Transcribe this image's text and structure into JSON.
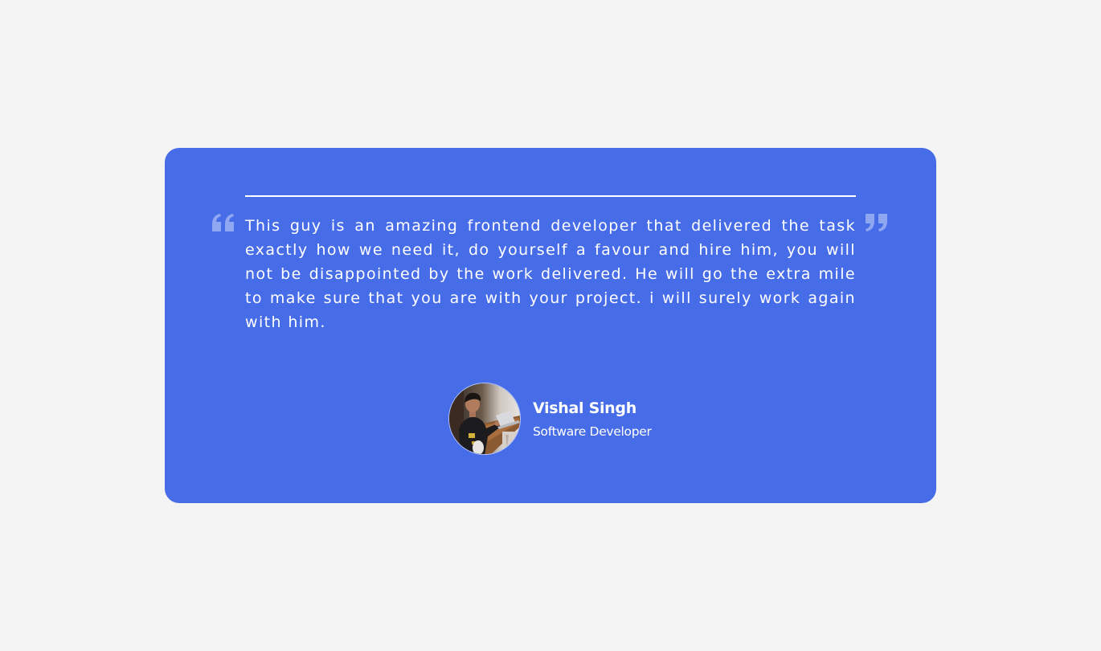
{
  "testimonial": {
    "quote": "This guy is an amazing frontend developer that delivered the task exactly how we need it, do yourself a favour and hire him, you will not be disappointed by the work delivered. He will go the extra mile to make sure that you are with your project. i will surely work again with him.",
    "progress": 1.0,
    "author": {
      "name": "Vishal Singh",
      "role": "Software Developer",
      "avatar_icon": "person-with-laptop-photo"
    },
    "open_quote_icon": "open-quote-icon",
    "close_quote_icon": "close-quote-icon"
  },
  "colors": {
    "background": "#f4f4f4",
    "card": "#476ce8",
    "text": "#ffffff",
    "quote_icon": "#8fa6f1"
  }
}
